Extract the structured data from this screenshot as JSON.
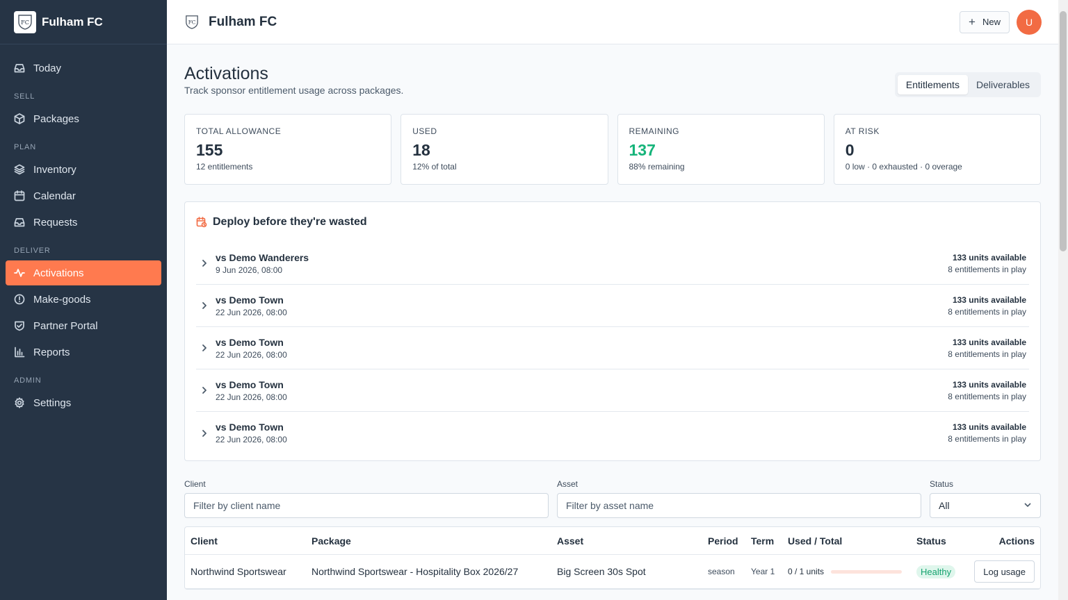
{
  "brand": {
    "name": "Fulham FC",
    "crest_icon": "club-crest-icon"
  },
  "nav": {
    "today": "Today",
    "section_sell": "SELL",
    "packages": "Packages",
    "section_plan": "PLAN",
    "inventory": "Inventory",
    "calendar": "Calendar",
    "requests": "Requests",
    "section_deliver": "DELIVER",
    "activations": "Activations",
    "makegoods": "Make-goods",
    "partner_portal": "Partner Portal",
    "reports": "Reports",
    "section_admin": "ADMIN",
    "settings": "Settings"
  },
  "topbar": {
    "title": "Fulham FC",
    "new_label": "New",
    "avatar_initial": "U"
  },
  "page": {
    "title": "Activations",
    "subtitle": "Track sponsor entitlement usage across packages.",
    "tabs": [
      "Entitlements",
      "Deliverables"
    ]
  },
  "stats": [
    {
      "label": "TOTAL ALLOWANCE",
      "value": "155",
      "sub": "12 entitlements"
    },
    {
      "label": "USED",
      "value": "18",
      "sub": "12% of total"
    },
    {
      "label": "REMAINING",
      "value": "137",
      "sub": "88% remaining"
    },
    {
      "label": "AT RISK",
      "value": "0",
      "sub": "0 low · 0 exhausted · 0 overage"
    }
  ],
  "deploy": {
    "title": "Deploy before they're wasted",
    "fixtures": [
      {
        "opponent": "vs Demo Wanderers",
        "date": "9 Jun 2026, 08:00",
        "units": "133 units available",
        "in_play": "8 entitlements in play"
      },
      {
        "opponent": "vs Demo Town",
        "date": "22 Jun 2026, 08:00",
        "units": "133 units available",
        "in_play": "8 entitlements in play"
      },
      {
        "opponent": "vs Demo Town",
        "date": "22 Jun 2026, 08:00",
        "units": "133 units available",
        "in_play": "8 entitlements in play"
      },
      {
        "opponent": "vs Demo Town",
        "date": "22 Jun 2026, 08:00",
        "units": "133 units available",
        "in_play": "8 entitlements in play"
      },
      {
        "opponent": "vs Demo Town",
        "date": "22 Jun 2026, 08:00",
        "units": "133 units available",
        "in_play": "8 entitlements in play"
      }
    ]
  },
  "filters": {
    "client_label": "Client",
    "client_placeholder": "Filter by client name",
    "asset_label": "Asset",
    "asset_placeholder": "Filter by asset name",
    "status_label": "Status",
    "status_value": "All"
  },
  "table": {
    "headers": [
      "Client",
      "Package",
      "Asset",
      "Period",
      "Term",
      "Used / Total",
      "Status",
      "Actions"
    ],
    "rows": [
      {
        "client": "Northwind Sportswear",
        "package": "Northwind Sportswear - Hospitality Box 2026/27",
        "asset": "Big Screen 30s Spot",
        "period": "season",
        "term": "Year 1",
        "used_total": "0 / 1 units",
        "usage_fraction": 0,
        "status": "Healthy",
        "action": "Log usage"
      }
    ]
  },
  "colors": {
    "accent": "#ff7a4f",
    "sidebar": "#263445",
    "healthy": "#16b47a"
  }
}
